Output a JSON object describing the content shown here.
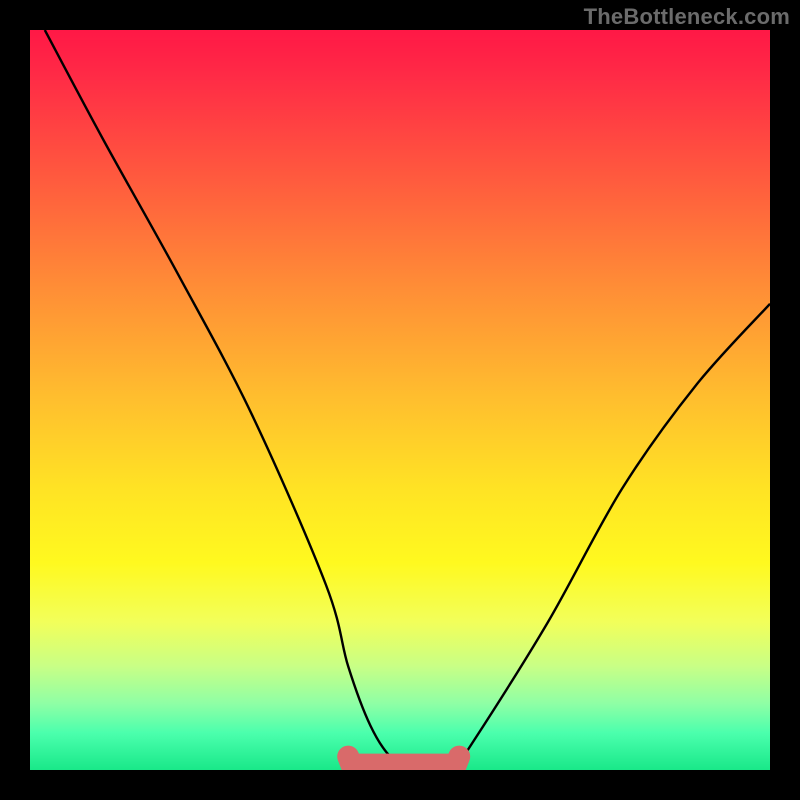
{
  "watermark": "TheBottleneck.com",
  "colors": {
    "accent": "#d96a6a",
    "curve": "#000000",
    "frame": "#000000"
  },
  "chart_data": {
    "type": "line",
    "title": "",
    "xlabel": "",
    "ylabel": "",
    "xlim": [
      0,
      100
    ],
    "ylim": [
      0,
      100
    ],
    "grid": false,
    "legend": false,
    "series": [
      {
        "name": "curve",
        "x": [
          2,
          10,
          20,
          30,
          40,
          43,
          46,
          49,
          52,
          55,
          58,
          60,
          70,
          80,
          90,
          100
        ],
        "y": [
          100,
          85,
          67,
          48,
          25,
          14,
          6,
          1.5,
          0.5,
          0.5,
          1.5,
          4,
          20,
          38,
          52,
          63
        ]
      }
    ],
    "accent_band": {
      "x_start": 43,
      "x_end": 58,
      "y": 1
    }
  }
}
